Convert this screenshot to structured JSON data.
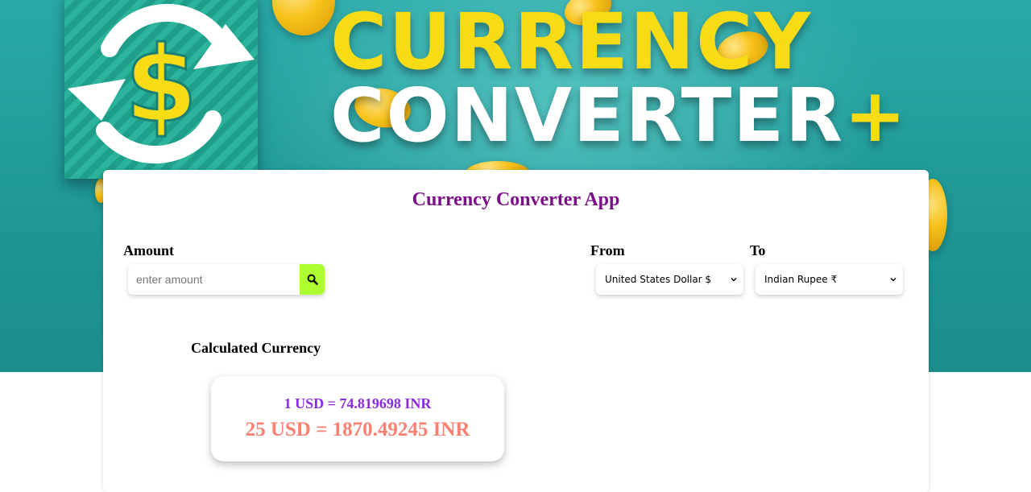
{
  "banner": {
    "line1": "CURRENCY",
    "line2": "CONVERTER",
    "plus": "+"
  },
  "app": {
    "title": "Currency Converter App"
  },
  "amount": {
    "label": "Amount",
    "placeholder": "enter amount",
    "value": "",
    "search_icon": "search-icon"
  },
  "from": {
    "label": "From",
    "selected": "United States Dollar $"
  },
  "to": {
    "label": "To",
    "selected": "Indian Rupee ₹"
  },
  "result": {
    "heading": "Calculated Currency",
    "rate_text": "1 USD = 74.819698 INR",
    "total_text": "25 USD = 1870.49245 INR"
  },
  "colors": {
    "title": "#7b0f8a",
    "search_button": "#adff2f",
    "rate_text": "#8a2be2",
    "total_text": "#fa8072",
    "banner_bg": "#1e9694",
    "banner_yellow": "#f7dc15"
  }
}
